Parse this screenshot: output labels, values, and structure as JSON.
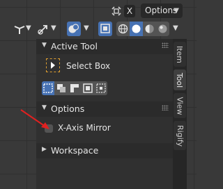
{
  "header": {
    "top": {
      "x_label": "X",
      "options_label": "Options"
    }
  },
  "sidebar_panel": {
    "active_tool": {
      "title": "Active Tool",
      "tool_name": "Select Box"
    },
    "options": {
      "title": "Options",
      "x_axis_mirror_label": "X-Axis Mirror"
    },
    "workspace": {
      "title": "Workspace"
    }
  },
  "tabs": [
    "Item",
    "Tool",
    "View",
    "Rigify"
  ],
  "colors": {
    "accent": "#4772b3",
    "panel_bg": "#303030",
    "header_bg": "#2b2b2b",
    "annotation_arrow": "#e02020"
  }
}
